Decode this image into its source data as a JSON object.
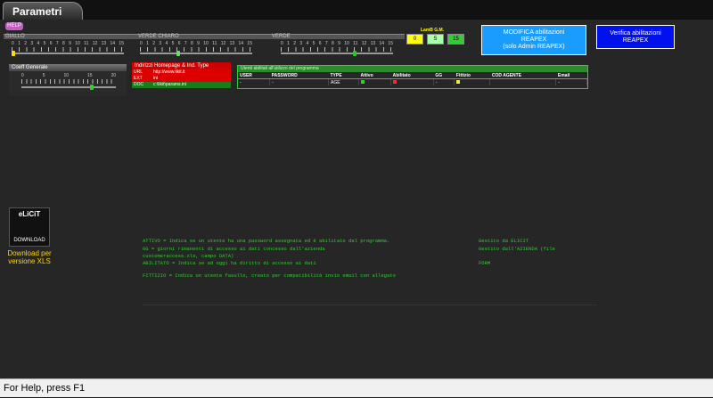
{
  "tab": {
    "title": "Parametri"
  },
  "help_label": "HELP",
  "sliders": [
    {
      "id": "giallo",
      "label": "GIALLO",
      "ticks": [
        "0",
        "1",
        "2",
        "3",
        "4",
        "5",
        "6",
        "7",
        "8",
        "9",
        "10",
        "11",
        "12",
        "13",
        "14",
        "15"
      ],
      "value": 0,
      "thumb_color": "#ffdd00"
    },
    {
      "id": "verde_chiaro",
      "label": "VERDE CHIARO",
      "ticks": [
        "0",
        "1",
        "2",
        "3",
        "4",
        "5",
        "6",
        "7",
        "8",
        "9",
        "10",
        "11",
        "12",
        "13",
        "14",
        "15"
      ],
      "value": 5,
      "thumb_color": "#66dd66"
    },
    {
      "id": "verde",
      "label": "VERDE",
      "ticks": [
        "0",
        "1",
        "2",
        "3",
        "4",
        "5",
        "6",
        "7",
        "8",
        "9",
        "10",
        "11",
        "12",
        "13",
        "14",
        "15"
      ],
      "value": 10,
      "thumb_color": "#22cc22"
    }
  ],
  "lamb": {
    "label": "LamB G.M.",
    "boxes": [
      {
        "value": "0",
        "color": "#ffff00"
      },
      {
        "value": "5",
        "color": "#aaffaa"
      },
      {
        "value": "15",
        "color": "#33cc33"
      }
    ]
  },
  "btn_modifica": {
    "line1": "MODIFICA abilitazioni",
    "line2": "REAPEX",
    "line3": "(solo Admin REAPEX)"
  },
  "btn_verifica": {
    "line1": "Verifica abilitazioni",
    "line2": "REAPEX"
  },
  "coeff": {
    "title": "Coeff Generale",
    "ticks": [
      "0",
      "5",
      "10",
      "15",
      "20"
    ],
    "value": 15
  },
  "homepage": {
    "title": "Indirizzi Homepage & Ind. Type",
    "rows": [
      {
        "k": "URL",
        "v": "http://www.likit.it"
      },
      {
        "k": "EXT",
        "v": "ini"
      },
      {
        "k": "DOC",
        "v": "c:\\likit\\params.ini"
      }
    ]
  },
  "users": {
    "title": "Utenti abilitati all'utilizzo del programma",
    "columns": [
      "USER",
      "PASSWORD",
      "TYPE",
      "Attivo",
      "Abilitato",
      "GG",
      "Fittizio",
      "COD AGENTE",
      "Email"
    ],
    "row": [
      "-",
      "-",
      "AGE",
      "",
      "",
      "-",
      "",
      "",
      "-"
    ]
  },
  "download": {
    "logo": "eLiCiT",
    "button": "DOWNLOAD",
    "text1": "Download per",
    "text2": "versione XLS"
  },
  "legend": [
    {
      "left": "ATTIVO     = Indica se un utente ha una password assegnata ed è abilitato dal programma.",
      "right": "Gestito da ELICIT"
    },
    {
      "left": "GG         = giorni rimanenti di accesso ai dati concesso dall'azienda",
      "right": "Gestito dall'AZIENDA (file"
    },
    {
      "left": "customeraccess.xls, campo DATA)",
      "right": ""
    },
    {
      "left": "ABILITATO  = Indica se ad oggi ha diritto di accesso ai dati",
      "right": "FORM"
    },
    {
      "left": "FITTIZIO   = Indica un utente fasullo, creato per compatibilità invio email con allegato",
      "right": ""
    }
  ],
  "status": "For Help, press F1"
}
